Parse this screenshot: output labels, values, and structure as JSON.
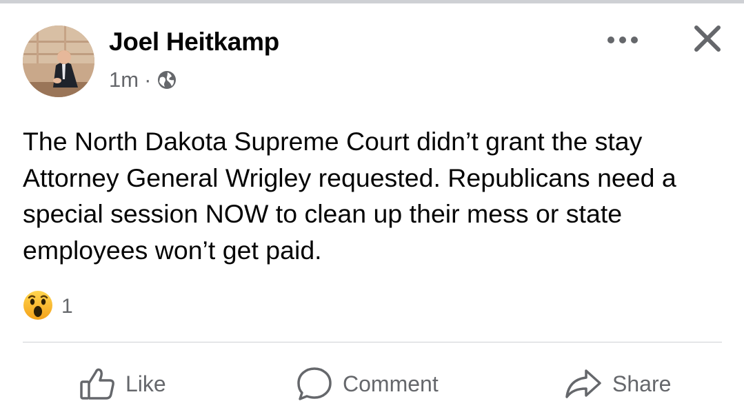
{
  "post": {
    "author": "Joel Heitkamp",
    "time": "1m",
    "separator": "·",
    "privacy_icon": "globe-icon",
    "text": "The North Dakota Supreme Court didn’t grant the stay Attorney General Wrigley requested. Republicans need a special session NOW to clean up their mess or state employees won’t get paid."
  },
  "reactions": {
    "icon": "wow-icon",
    "count": "1"
  },
  "actions": {
    "like": "Like",
    "comment": "Comment",
    "share": "Share"
  },
  "colors": {
    "text": "#050505",
    "secondary": "#65676b",
    "divider": "#ced0d4",
    "wow_face": "#f7b125"
  }
}
